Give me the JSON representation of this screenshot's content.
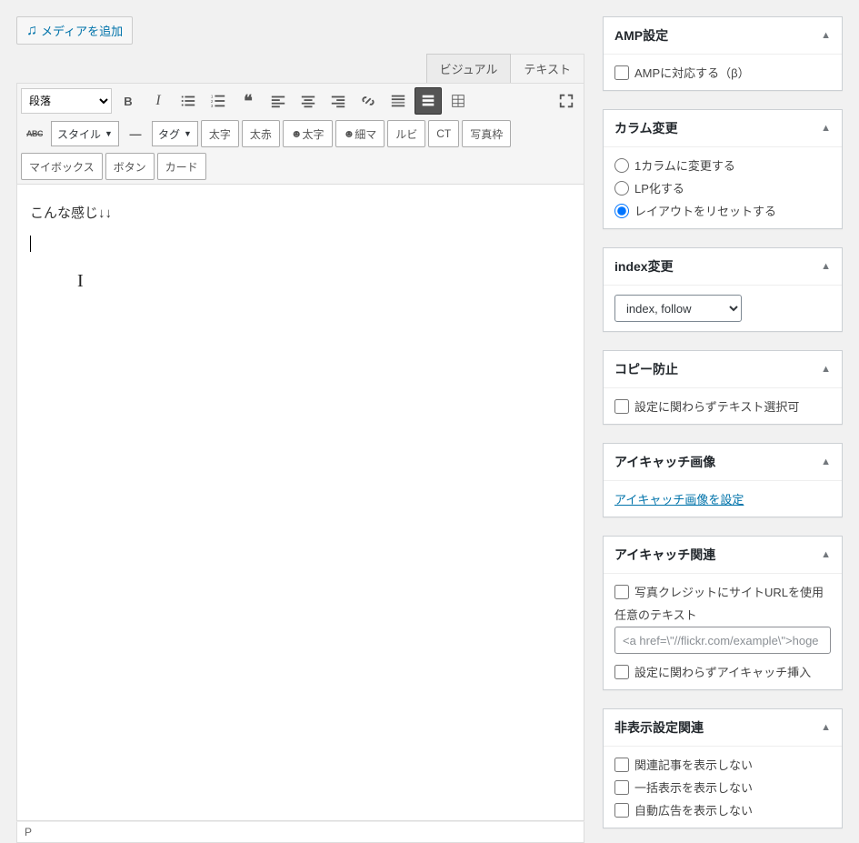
{
  "media_button": "メディアを追加",
  "editor_tabs": {
    "visual": "ビジュアル",
    "text": "テキスト"
  },
  "format_dropdown": "段落",
  "style_dropdown": "スタイル",
  "tag_dropdown": "タグ",
  "buttons": {
    "bold": "太字",
    "red": "太赤",
    "big_text": "太字",
    "ribbon": "細マ",
    "ruby": "ルビ",
    "ct": "CT",
    "photo_frame": "写真枠",
    "mybox": "マイボックス",
    "btn": "ボタン",
    "card": "カード"
  },
  "content": "こんな感じ↓↓",
  "status_path": "P",
  "sidebar": {
    "amp": {
      "title": "AMP設定",
      "option": "AMPに対応する（β）"
    },
    "column": {
      "title": "カラム変更",
      "opt1": "1カラムに変更する",
      "opt2": "LP化する",
      "opt3": "レイアウトをリセットする"
    },
    "index": {
      "title": "index変更",
      "value": "index, follow"
    },
    "copy": {
      "title": "コピー防止",
      "option": "設定に関わらずテキスト選択可"
    },
    "eyecatch_img": {
      "title": "アイキャッチ画像",
      "link": "アイキャッチ画像を設定"
    },
    "eyecatch_rel": {
      "title": "アイキャッチ関連",
      "opt1": "写真クレジットにサイトURLを使用",
      "text_label": "任意のテキスト",
      "placeholder": "<a href=\\\"//flickr.com/example\\\">hoge",
      "opt2": "設定に関わらずアイキャッチ挿入"
    },
    "hide": {
      "title": "非表示設定関連",
      "opt1": "関連記事を表示しない",
      "opt2": "一括表示を表示しない",
      "opt3": "自動広告を表示しない"
    }
  }
}
